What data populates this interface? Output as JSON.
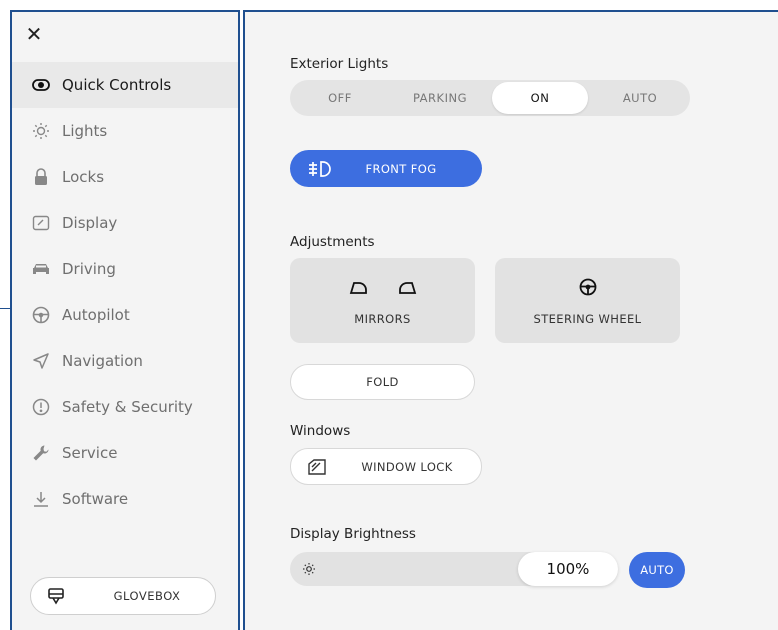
{
  "sidebar": {
    "items": [
      {
        "label": "Quick Controls",
        "icon": "toggle-icon",
        "active": true
      },
      {
        "label": "Lights",
        "icon": "sun-icon"
      },
      {
        "label": "Locks",
        "icon": "lock-icon"
      },
      {
        "label": "Display",
        "icon": "display-icon"
      },
      {
        "label": "Driving",
        "icon": "car-icon"
      },
      {
        "label": "Autopilot",
        "icon": "steering-wheel-icon"
      },
      {
        "label": "Navigation",
        "icon": "navigation-arrow-icon"
      },
      {
        "label": "Safety & Security",
        "icon": "alert-circle-icon"
      },
      {
        "label": "Service",
        "icon": "wrench-icon"
      },
      {
        "label": "Software",
        "icon": "download-icon"
      }
    ],
    "glovebox_label": "GLOVEBOX"
  },
  "main": {
    "exterior_lights": {
      "title": "Exterior Lights",
      "options": [
        "OFF",
        "PARKING",
        "ON",
        "AUTO"
      ],
      "selected": "ON"
    },
    "front_fog_label": "FRONT FOG",
    "adjustments": {
      "title": "Adjustments",
      "mirrors_label": "MIRRORS",
      "steering_label": "STEERING WHEEL",
      "fold_label": "FOLD"
    },
    "windows": {
      "title": "Windows",
      "window_lock_label": "WINDOW LOCK"
    },
    "display_brightness": {
      "title": "Display Brightness",
      "value": "100%",
      "auto_label": "AUTO"
    }
  },
  "colors": {
    "accent": "#3d6ee0",
    "frame": "#1f4f8f"
  }
}
